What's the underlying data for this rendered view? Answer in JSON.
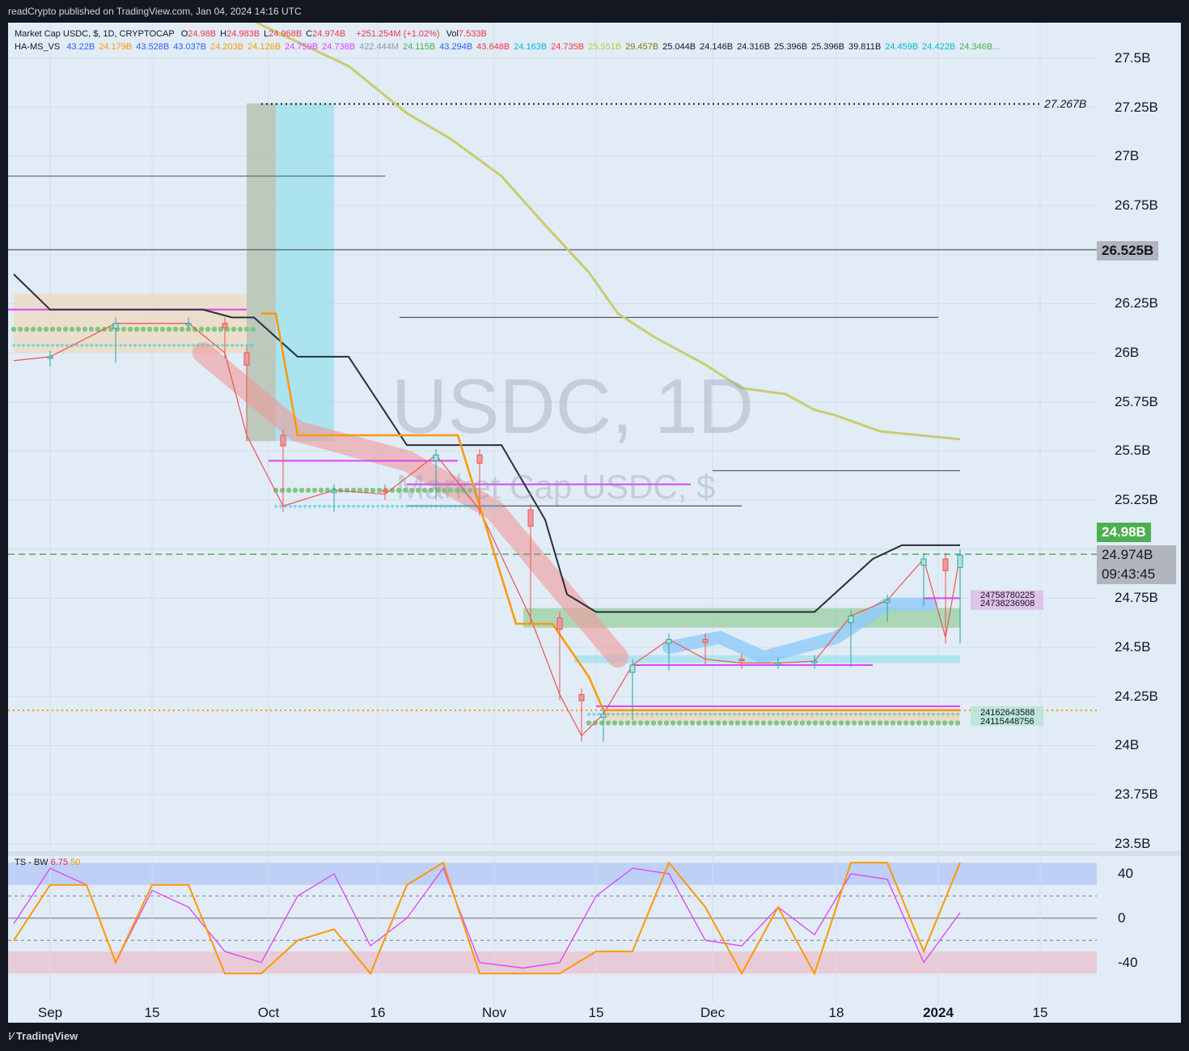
{
  "header": {
    "publish_text": "readCrypto published on TradingView.com, Jan 04, 2024 14:16 UTC"
  },
  "footer": {
    "brand": "TradingView"
  },
  "legend": {
    "symbol_line": "Market Cap USDC, $, 1D, CRYPTOCAP",
    "ohlc": [
      {
        "label": "O",
        "value": "24.98B"
      },
      {
        "label": "H",
        "value": "24.983B"
      },
      {
        "label": "L",
        "value": "24.968B"
      },
      {
        "label": "C",
        "value": "24.974B"
      }
    ],
    "change": "+251.254M (+1.02%)",
    "vol_label": "Vol",
    "vol_value": "7.533B",
    "indicator_name": "HA-MS_VS",
    "indicator_values": [
      {
        "v": "43.22B",
        "c": "#2962ff"
      },
      {
        "v": "24.179B",
        "c": "#ff9800"
      },
      {
        "v": "43.528B",
        "c": "#2962ff"
      },
      {
        "v": "43.037B",
        "c": "#2962ff"
      },
      {
        "v": "24.203B",
        "c": "#ff9800"
      },
      {
        "v": "24.126B",
        "c": "#ff9800"
      },
      {
        "v": "24.759B",
        "c": "#e040fb"
      },
      {
        "v": "24.738B",
        "c": "#e040fb"
      },
      {
        "v": "422.444M",
        "c": "#9598a1"
      },
      {
        "v": "24.115B",
        "c": "#4caf50"
      },
      {
        "v": "43.294B",
        "c": "#2962ff"
      },
      {
        "v": "43.648B",
        "c": "#f23645"
      },
      {
        "v": "24.163B",
        "c": "#00bcd4"
      },
      {
        "v": "24.735B",
        "c": "#f23645"
      },
      {
        "v": "25.551B",
        "c": "#c0ca33"
      },
      {
        "v": "29.457B",
        "c": "#827717"
      },
      {
        "v": "25.044B",
        "c": "#131722"
      },
      {
        "v": "24.146B",
        "c": "#131722"
      },
      {
        "v": "24.316B",
        "c": "#131722"
      },
      {
        "v": "25.396B",
        "c": "#131722"
      },
      {
        "v": "25.396B",
        "c": "#131722"
      },
      {
        "v": "39.811B",
        "c": "#131722"
      },
      {
        "v": "24.459B",
        "c": "#00bcd4"
      },
      {
        "v": "24.422B",
        "c": "#00bcd4"
      },
      {
        "v": "24.346B...",
        "c": "#4caf50"
      }
    ]
  },
  "watermark": {
    "big": "USDC, 1D",
    "small": "Market Cap USDC, $"
  },
  "annotations": {
    "high_label": "27.267B",
    "upper_tag": "26.525B",
    "current_price_tag": "24.98B",
    "last_close_tag": "24.974B",
    "countdown": "09:43:45",
    "magenta_box": [
      "24758780225",
      "24738236908"
    ],
    "green_box": [
      "24162643588",
      "24115448756"
    ]
  },
  "osc": {
    "name": "TS - BW",
    "v1": "6.75",
    "v2": "50"
  },
  "colors": {
    "bg": "#e1ecf7",
    "up": "#26a69a",
    "down": "#ef5350",
    "black_line": "#2a2e39",
    "olive_line": "#c9cc6e",
    "orange": "#ff9800",
    "magenta": "#e040fb",
    "teal_fill": "#80deea",
    "green_fill": "#81c784",
    "pink_band": "#ef9a9a",
    "blue_band": "#90caf9"
  },
  "chart_data": [
    {
      "type": "line",
      "title": "",
      "ylabel": "",
      "ylim": [
        23.5,
        27.75
      ],
      "y_ticks": [
        "27.5B",
        "27.25B",
        "27B",
        "26.75B",
        "26.5B",
        "26.25B",
        "26B",
        "25.75B",
        "25.5B",
        "25.25B",
        "25B",
        "24.75B",
        "24.5B",
        "24.25B",
        "24B",
        "23.75B",
        "23.5B"
      ],
      "y_tick_values": [
        27.5,
        27.25,
        27,
        26.75,
        26.5,
        26.25,
        26,
        25.75,
        25.5,
        25.25,
        25,
        24.75,
        24.5,
        24.25,
        24,
        23.75,
        23.5
      ],
      "x_ticks": [
        "Sep",
        "15",
        "Oct",
        "16",
        "Nov",
        "15",
        "Dec",
        "18",
        "2024",
        "15"
      ],
      "x_tick_dates": [
        "2023-09-01",
        "2023-09-15",
        "2023-10-01",
        "2023-10-16",
        "2023-11-01",
        "2023-11-15",
        "2023-12-01",
        "2023-12-18",
        "2024-01-01",
        "2024-01-15"
      ],
      "series": [
        {
          "dates": [
            "2023-08-27",
            "2023-09-01",
            "2023-09-10",
            "2023-09-20",
            "2023-09-25",
            "2023-09-28",
            "2023-10-03",
            "2023-10-10",
            "2023-10-17",
            "2023-10-24",
            "2023-10-30",
            "2023-11-06",
            "2023-11-10",
            "2023-11-13",
            "2023-11-16",
            "2023-11-20",
            "2023-11-25",
            "2023-11-30",
            "2023-12-05",
            "2023-12-10",
            "2023-12-15",
            "2023-12-20",
            "2023-12-25",
            "2023-12-30",
            "2024-01-02",
            "2024-01-04"
          ],
          "values": [
            25.96,
            25.98,
            26.15,
            26.15,
            26.0,
            25.58,
            25.22,
            25.3,
            25.28,
            25.48,
            25.2,
            24.65,
            24.26,
            24.05,
            24.16,
            24.41,
            24.54,
            24.44,
            24.42,
            24.42,
            24.43,
            24.66,
            24.74,
            24.95,
            24.55,
            24.97
          ]
        },
        {
          "dates": [
            "2023-08-27",
            "2023-09-01",
            "2023-09-22",
            "2023-09-26",
            "2023-09-29",
            "2023-10-05",
            "2023-10-12",
            "2023-10-20",
            "2023-10-27",
            "2023-11-02",
            "2023-11-08",
            "2023-11-11",
            "2023-11-15",
            "2023-11-29",
            "2023-12-02",
            "2023-12-14",
            "2023-12-15",
            "2023-12-23",
            "2023-12-27",
            "2024-01-04"
          ],
          "values": [
            26.4,
            26.22,
            26.22,
            26.18,
            26.18,
            25.98,
            25.98,
            25.53,
            25.53,
            25.53,
            25.15,
            24.77,
            24.68,
            24.68,
            24.68,
            24.68,
            24.68,
            24.95,
            25.02,
            25.02
          ]
        },
        {
          "dates": [
            "2023-08-27",
            "2023-09-20",
            "2023-09-30",
            "2023-10-12",
            "2023-10-20",
            "2023-10-26",
            "2023-11-02",
            "2023-11-08",
            "2023-11-14",
            "2023-11-18",
            "2023-11-23",
            "2023-11-30",
            "2023-12-05",
            "2023-12-11",
            "2023-12-15",
            "2023-12-18",
            "2023-12-24",
            "2024-01-04"
          ],
          "values": [
            27.9,
            27.9,
            27.67,
            27.46,
            27.22,
            27.09,
            26.9,
            26.65,
            26.41,
            26.2,
            26.08,
            25.94,
            25.82,
            25.79,
            25.71,
            25.68,
            25.6,
            25.56
          ]
        },
        {
          "dates": [
            "2023-09-30",
            "2023-10-02",
            "2023-10-05",
            "2023-10-27",
            "2023-11-04",
            "2023-11-09",
            "2023-11-14",
            "2023-11-16",
            "2024-01-04"
          ],
          "values": [
            26.2,
            26.2,
            25.58,
            25.58,
            24.62,
            24.62,
            24.35,
            24.18,
            24.18
          ]
        }
      ]
    },
    {
      "type": "line",
      "title": "",
      "ylim": [
        -50,
        50
      ],
      "y_ticks": [
        "40",
        "0",
        "-40"
      ],
      "y_tick_values": [
        40,
        0,
        -40
      ],
      "series": [
        {
          "dates": [
            "2023-08-27",
            "2023-09-01",
            "2023-09-06",
            "2023-09-10",
            "2023-09-15",
            "2023-09-20",
            "2023-09-25",
            "2023-09-30",
            "2023-10-05",
            "2023-10-10",
            "2023-10-15",
            "2023-10-20",
            "2023-10-25",
            "2023-10-30",
            "2023-11-05",
            "2023-11-10",
            "2023-11-15",
            "2023-11-20",
            "2023-11-25",
            "2023-11-30",
            "2023-12-05",
            "2023-12-10",
            "2023-12-15",
            "2023-12-20",
            "2023-12-25",
            "2023-12-30",
            "2024-01-04"
          ],
          "values": [
            -5,
            45,
            30,
            -40,
            25,
            10,
            -30,
            -40,
            20,
            40,
            -25,
            0,
            45,
            -40,
            -45,
            -40,
            20,
            45,
            40,
            -20,
            -25,
            10,
            -15,
            40,
            35,
            -40,
            5
          ]
        },
        {
          "dates": [
            "2023-08-27",
            "2023-09-01",
            "2023-09-06",
            "2023-09-10",
            "2023-09-15",
            "2023-09-20",
            "2023-09-25",
            "2023-09-30",
            "2023-10-05",
            "2023-10-10",
            "2023-10-15",
            "2023-10-20",
            "2023-10-25",
            "2023-10-30",
            "2023-11-05",
            "2023-11-10",
            "2023-11-15",
            "2023-11-20",
            "2023-11-25",
            "2023-11-30",
            "2023-12-05",
            "2023-12-10",
            "2023-12-15",
            "2023-12-20",
            "2023-12-25",
            "2023-12-30",
            "2024-01-04"
          ],
          "values": [
            -20,
            30,
            30,
            -40,
            30,
            30,
            -50,
            -50,
            -20,
            -10,
            -50,
            30,
            50,
            -50,
            -50,
            -50,
            -30,
            -30,
            50,
            10,
            -50,
            10,
            -50,
            50,
            50,
            -30,
            50
          ]
        }
      ]
    }
  ]
}
